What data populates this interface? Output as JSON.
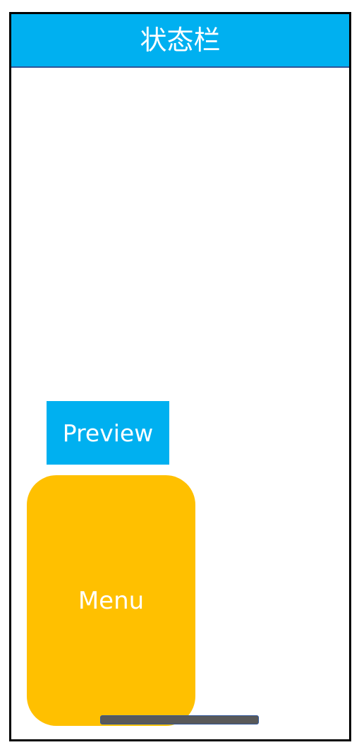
{
  "status_bar": {
    "label": "状态栏",
    "color": "#00b0f0"
  },
  "preview": {
    "label": "Preview",
    "color": "#00b0f0"
  },
  "menu": {
    "label": "Menu",
    "color": "#ffc000"
  },
  "home_indicator": {
    "color": "#595959"
  }
}
